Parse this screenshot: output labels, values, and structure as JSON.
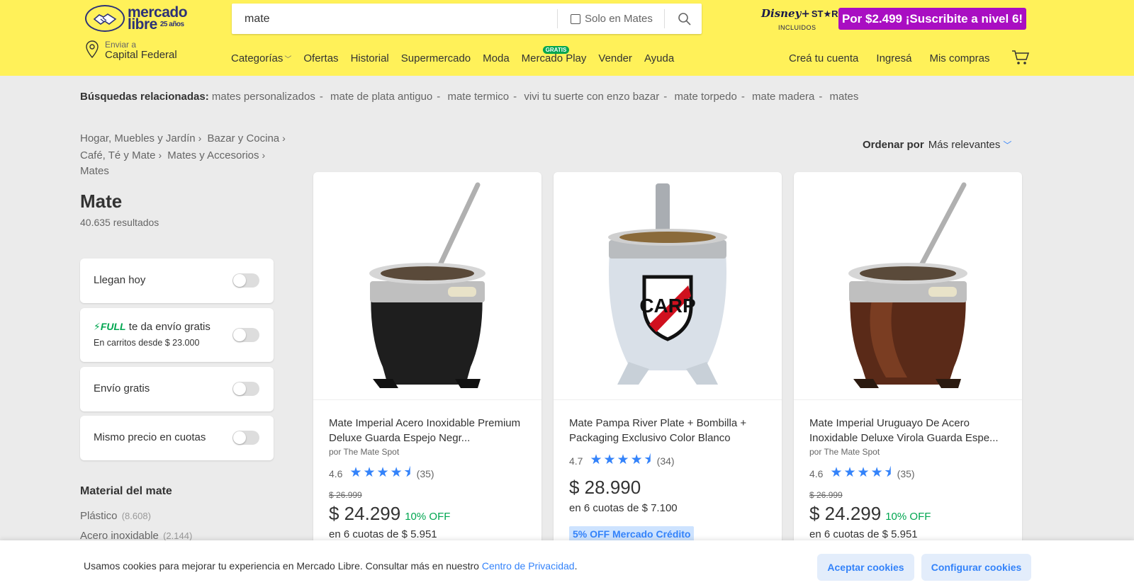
{
  "header": {
    "logo_line1": "mercado",
    "logo_line2": "libre",
    "logo_years": "25 años",
    "search": {
      "value": "mate",
      "solo_label": "Solo en Mates"
    },
    "disney_brand": "Disney+",
    "star_brand": "ST★R+",
    "disney_incl": "INCLUIDOS",
    "promo": "Por $2.499 ¡Suscribite a nivel 6!",
    "location": {
      "small": "Enviar a",
      "big": "Capital Federal"
    },
    "nav": [
      {
        "label": "Categorías",
        "name": "nav-categorias"
      },
      {
        "label": "Ofertas",
        "name": "nav-ofertas"
      },
      {
        "label": "Historial",
        "name": "nav-historial"
      },
      {
        "label": "Supermercado",
        "name": "nav-supermercado"
      },
      {
        "label": "Moda",
        "name": "nav-moda"
      },
      {
        "label": "Mercado Play",
        "name": "nav-mercado-play"
      },
      {
        "label": "Vender",
        "name": "nav-vender"
      },
      {
        "label": "Ayuda",
        "name": "nav-ayuda"
      }
    ],
    "gratis_badge": "GRATIS",
    "account": {
      "create": "Creá tu cuenta",
      "login": "Ingresá",
      "purchases": "Mis compras"
    }
  },
  "related": {
    "label": "Búsquedas relacionadas:",
    "items": [
      "mates personalizados",
      "mate de plata antiguo",
      "mate termico",
      "vivi tu suerte con enzo bazar",
      "mate torpedo",
      "mate madera",
      "mates"
    ]
  },
  "breadcrumb": [
    "Hogar, Muebles y Jardín",
    "Bazar y Cocina",
    "Café, Té y Mate",
    "Mates y Accesorios",
    "Mates"
  ],
  "sort": {
    "label": "Ordenar por",
    "value": "Más relevantes"
  },
  "results": {
    "title": "Mate",
    "count": "40.635 resultados"
  },
  "filters": {
    "llegan_hoy": "Llegan hoy",
    "full_brand": "FULL",
    "full_text": "te da envío gratis",
    "full_sub": "En carritos desde $ 23.000",
    "envio_gratis": "Envío gratis",
    "mismo_precio": "Mismo precio en cuotas"
  },
  "material": {
    "title": "Material del mate",
    "items": [
      {
        "label": "Plástico",
        "qty": "(8.608)"
      },
      {
        "label": "Acero inoxidable",
        "qty": "(2.144)"
      }
    ]
  },
  "products": [
    {
      "title": "Mate Imperial Acero Inoxidable Premium Deluxe Guarda Espejo Negr...",
      "seller": "por The Mate Spot",
      "rating": "4.6",
      "stars": "★★★★⯨",
      "reviews": "(35)",
      "old_price": "$ 26.999",
      "price": "$ 24.299",
      "discount": "10% OFF",
      "installments": "en 6 cuotas de $ 5.951"
    },
    {
      "title": "Mate Pampa River Plate + Bombilla + Packaging Exclusivo Color Blanco",
      "seller": "",
      "rating": "4.7",
      "stars": "★★★★⯨",
      "reviews": "(34)",
      "old_price": "",
      "price": "$ 28.990",
      "discount": "",
      "installments": "en 6 cuotas de $ 7.100",
      "credit_badge": "5% OFF Mercado Crédito"
    },
    {
      "title": "Mate Imperial Uruguayo De Acero Inoxidable Deluxe Virola Guarda Espe...",
      "seller": "por The Mate Spot",
      "rating": "4.6",
      "stars": "★★★★⯨",
      "reviews": "(35)",
      "old_price": "$ 26.999",
      "price": "$ 24.299",
      "discount": "10% OFF",
      "installments": "en 6 cuotas de $ 5.951"
    }
  ],
  "cookie": {
    "text": "Usamos cookies para mejorar tu experiencia en Mercado Libre. Consultar más en nuestro",
    "link": "Centro de Privacidad",
    "dot": ".",
    "accept": "Aceptar cookies",
    "configure": "Configurar cookies"
  },
  "colors": {
    "header_bg": "#fff159",
    "accent": "#3483fa",
    "green": "#00a650",
    "promo": "#a90ec2"
  }
}
